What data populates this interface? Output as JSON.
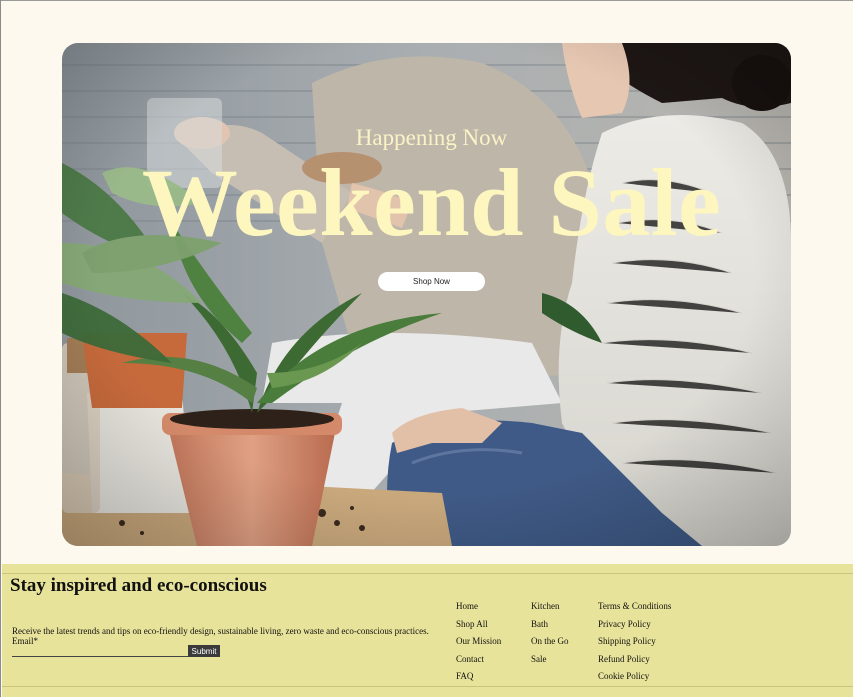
{
  "hero": {
    "subtitle": "Happening Now",
    "title": "Weekend Sale",
    "button_label": "Shop Now",
    "text_color": "#fdf6be"
  },
  "footer": {
    "heading": "Stay inspired and eco-conscious",
    "description": "Receive the latest trends and tips on eco-friendly design, sustainable living, zero waste and eco-conscious practices.",
    "email_label": "Email*",
    "email_value": "",
    "submit_label": "Submit",
    "background": "#e8e39a",
    "nav_col1": [
      "Home",
      "Shop All",
      "Our Mission",
      "Contact",
      "FAQ"
    ],
    "nav_col2": [
      "Kitchen",
      "Bath",
      "On the Go",
      "Sale"
    ],
    "nav_col3": [
      "Terms & Conditions",
      "Privacy Policy",
      "Shipping Policy",
      "Refund Policy",
      "Cookie Policy"
    ]
  }
}
